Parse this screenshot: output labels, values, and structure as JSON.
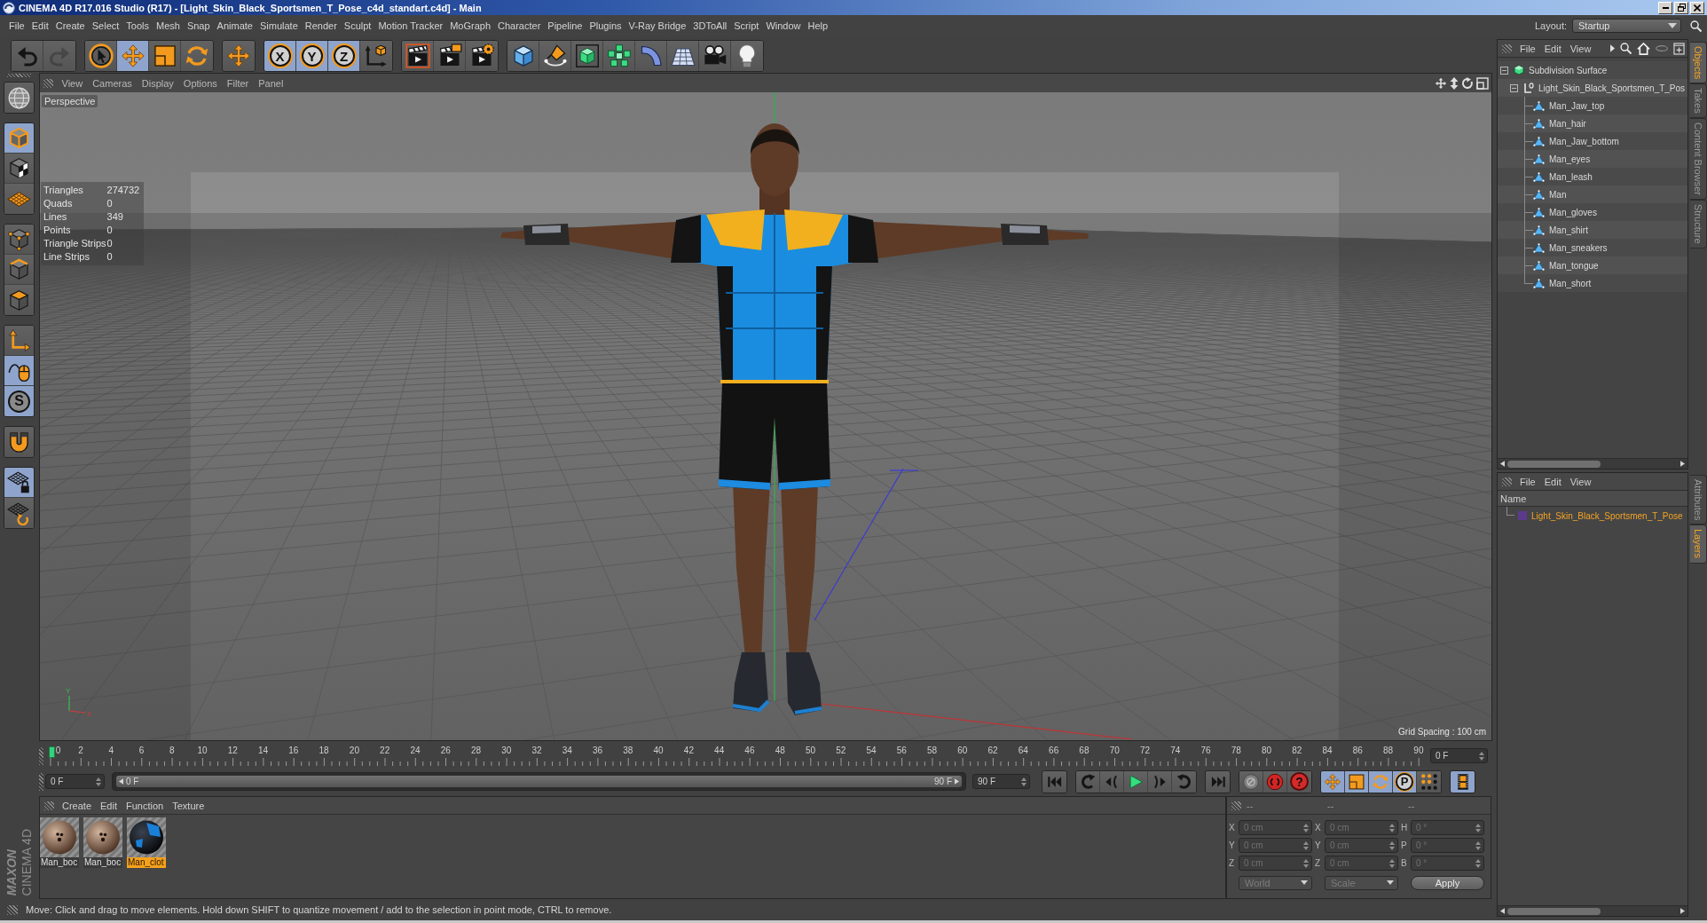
{
  "window": {
    "title": "CINEMA 4D R17.016 Studio (R17) - [Light_Skin_Black_Sportsmen_T_Pose_c4d_standart.c4d] - Main"
  },
  "menu_bar": {
    "items": [
      "File",
      "Edit",
      "Create",
      "Select",
      "Tools",
      "Mesh",
      "Snap",
      "Animate",
      "Simulate",
      "Render",
      "Sculpt",
      "Motion Tracker",
      "MoGraph",
      "Character",
      "Pipeline",
      "Plugins",
      "V-Ray Bridge",
      "3DToAll",
      "Script",
      "Window",
      "Help"
    ],
    "layout_label": "Layout:",
    "layout_value": "Startup"
  },
  "toolbar": {
    "groups": [
      [
        {
          "kind": "undo",
          "selected": false,
          "disabled": false
        },
        {
          "kind": "redo",
          "selected": false,
          "disabled": true
        }
      ],
      [
        {
          "kind": "live-select",
          "selected": false,
          "disabled": false
        },
        {
          "kind": "move",
          "selected": true,
          "disabled": false
        },
        {
          "kind": "scale",
          "selected": false,
          "disabled": false
        },
        {
          "kind": "rotate",
          "selected": false,
          "disabled": false
        }
      ],
      [
        {
          "kind": "recent-tool",
          "selected": false,
          "disabled": false
        }
      ],
      [
        {
          "kind": "axis",
          "label": "X",
          "selected": true,
          "disabled": false
        },
        {
          "kind": "axis",
          "label": "Y",
          "selected": true,
          "disabled": false
        },
        {
          "kind": "axis",
          "label": "Z",
          "selected": true,
          "disabled": false
        },
        {
          "kind": "coord-system",
          "selected": false,
          "disabled": false
        }
      ],
      [
        {
          "kind": "render-view",
          "selected": false,
          "disabled": false
        },
        {
          "kind": "render-picture",
          "selected": false,
          "disabled": false
        },
        {
          "kind": "render-settings",
          "selected": false,
          "disabled": false
        }
      ],
      [
        {
          "kind": "cube",
          "selected": false,
          "disabled": false
        },
        {
          "kind": "pen",
          "selected": false,
          "disabled": false
        },
        {
          "kind": "subdivision",
          "selected": false,
          "disabled": false
        },
        {
          "kind": "cloner",
          "selected": false,
          "disabled": false
        },
        {
          "kind": "deformer",
          "selected": false,
          "disabled": false
        },
        {
          "kind": "floor",
          "selected": false,
          "disabled": false
        },
        {
          "kind": "camera",
          "selected": false,
          "disabled": false
        },
        {
          "kind": "light",
          "selected": false,
          "disabled": false
        }
      ]
    ]
  },
  "mode_toolbar": {
    "groups": [
      [
        {
          "kind": "globe",
          "selected": false
        }
      ],
      [
        {
          "kind": "model",
          "selected": true
        },
        {
          "kind": "texture",
          "selected": false
        },
        {
          "kind": "workplane",
          "selected": false
        }
      ],
      [
        {
          "kind": "points",
          "selected": false
        },
        {
          "kind": "edges",
          "selected": false
        },
        {
          "kind": "polygons",
          "selected": false
        }
      ],
      [
        {
          "kind": "axis-mode",
          "selected": false
        },
        {
          "kind": "tweak",
          "selected": true
        },
        {
          "kind": "solo",
          "label": "S",
          "selected": true
        }
      ],
      [
        {
          "kind": "snap",
          "selected": false
        }
      ],
      [
        {
          "kind": "workplane-lock",
          "selected": true
        },
        {
          "kind": "workplane-align",
          "selected": false
        }
      ]
    ]
  },
  "viewport": {
    "menu": [
      "View",
      "Cameras",
      "Display",
      "Options",
      "Filter",
      "Panel"
    ],
    "camera": "Perspective",
    "stats": [
      {
        "label": "Triangles",
        "value": "274732"
      },
      {
        "label": "Quads",
        "value": "0"
      },
      {
        "label": "Lines",
        "value": "349"
      },
      {
        "label": "Points",
        "value": "0"
      },
      {
        "label": "Triangle Strips",
        "value": "0"
      },
      {
        "label": "Line Strips",
        "value": "0"
      }
    ],
    "axis_labels": [
      "Y",
      "X"
    ],
    "grid_spacing": "Grid Spacing : 100 cm"
  },
  "timeline": {
    "ticks": [
      "0",
      "2",
      "4",
      "6",
      "8",
      "10",
      "12",
      "14",
      "16",
      "18",
      "20",
      "22",
      "24",
      "26",
      "28",
      "30",
      "32",
      "34",
      "36",
      "38",
      "40",
      "42",
      "44",
      "46",
      "48",
      "50",
      "52",
      "54",
      "56",
      "58",
      "60",
      "62",
      "64",
      "66",
      "68",
      "70",
      "72",
      "74",
      "76",
      "78",
      "80",
      "82",
      "84",
      "86",
      "88",
      "90"
    ],
    "playhead": {
      "level": 0
    },
    "current_frame": "0 F",
    "start_frame": "0 F",
    "range": {
      "level": 1
    },
    "range_start": "0 F",
    "range_end": "90 F",
    "end_frame": "90 F",
    "transport": [
      [
        {
          "kind": "first-frame",
          "selected": false
        }
      ],
      [
        {
          "kind": "prev-key",
          "selected": false
        },
        {
          "kind": "prev-frame",
          "selected": false
        },
        {
          "kind": "play",
          "selected": false
        },
        {
          "kind": "next-frame",
          "selected": false
        },
        {
          "kind": "next-key",
          "selected": false
        }
      ],
      [
        {
          "kind": "last-frame",
          "selected": false
        }
      ],
      [
        {
          "kind": "record",
          "selected": false
        },
        {
          "kind": "autokey",
          "selected": false
        },
        {
          "kind": "key-selection",
          "label": "?",
          "selected": false
        }
      ],
      [
        {
          "kind": "key-position",
          "selected": true
        },
        {
          "kind": "key-scale",
          "selected": true
        },
        {
          "kind": "key-rotation",
          "selected": true
        },
        {
          "kind": "key-parameter",
          "label": "P",
          "selected": true
        },
        {
          "kind": "key-point-level",
          "selected": false
        }
      ],
      [
        {
          "kind": "timeline-window",
          "selected": true
        }
      ]
    ]
  },
  "materials": {
    "menu": [
      "Create",
      "Edit",
      "Function",
      "Texture"
    ],
    "items": [
      {
        "name": "Man_boc",
        "kind": "skin",
        "selected": false
      },
      {
        "name": "Man_boc",
        "kind": "skin",
        "selected": false
      },
      {
        "name": "Man_clot",
        "kind": "cloth",
        "selected": true
      }
    ]
  },
  "coordinates": {
    "disabled": true,
    "headers": [
      "--",
      "--",
      "--"
    ],
    "rows": [
      {
        "position_axis": "X",
        "position": "0 cm",
        "size_axis": "X",
        "size": "0 cm",
        "rotation_axis": "H",
        "rotation": "0 °"
      },
      {
        "position_axis": "Y",
        "position": "0 cm",
        "size_axis": "Y",
        "size": "0 cm",
        "rotation_axis": "P",
        "rotation": "0 °"
      },
      {
        "position_axis": "Z",
        "position": "0 cm",
        "size_axis": "Z",
        "size": "0 cm",
        "rotation_axis": "B",
        "rotation": "0 °"
      }
    ],
    "mode": "World",
    "size_mode": "Scale",
    "apply": "Apply"
  },
  "status_bar": {
    "text": "Move: Click and drag to move elements. Hold down SHIFT to quantize movement / add to the selection in point mode, CTRL to remove."
  },
  "logo": {
    "brand": "MAXON",
    "product": "CINEMA 4D"
  },
  "object_manager": {
    "menu": [
      "File",
      "Edit",
      "View"
    ],
    "tree": [
      {
        "name": "Subdivision Surface",
        "kind": "subdivision",
        "expanded": true,
        "children": [
          {
            "name": "Light_Skin_Black_Sportsmen_T_Pos",
            "kind": "null",
            "expanded": true,
            "children": [
              {
                "name": "Man_Jaw_top",
                "kind": "polygon"
              },
              {
                "name": "Man_hair",
                "kind": "polygon"
              },
              {
                "name": "Man_Jaw_bottom",
                "kind": "polygon"
              },
              {
                "name": "Man_eyes",
                "kind": "polygon"
              },
              {
                "name": "Man_leash",
                "kind": "polygon"
              },
              {
                "name": "Man",
                "kind": "polygon"
              },
              {
                "name": "Man_gloves",
                "kind": "polygon"
              },
              {
                "name": "Man_shirt",
                "kind": "polygon"
              },
              {
                "name": "Man_sneakers",
                "kind": "polygon"
              },
              {
                "name": "Man_tongue",
                "kind": "polygon"
              },
              {
                "name": "Man_short",
                "kind": "polygon"
              }
            ]
          }
        ]
      }
    ]
  },
  "object_tabs": [
    {
      "label": "Objects",
      "selected": true
    },
    {
      "label": "Takes",
      "selected": false
    },
    {
      "label": "Content Browser",
      "selected": false
    },
    {
      "label": "Structure",
      "selected": false
    }
  ],
  "layer_manager": {
    "menu": [
      "File",
      "Edit",
      "View"
    ],
    "column": "Name",
    "layers": [
      {
        "name": "Light_Skin_Black_Sportsmen_T_Pose",
        "color": "#5b3a8c"
      }
    ]
  },
  "layer_tabs": [
    {
      "label": "Attributes",
      "selected": false
    },
    {
      "label": "Layers",
      "selected": true
    }
  ]
}
